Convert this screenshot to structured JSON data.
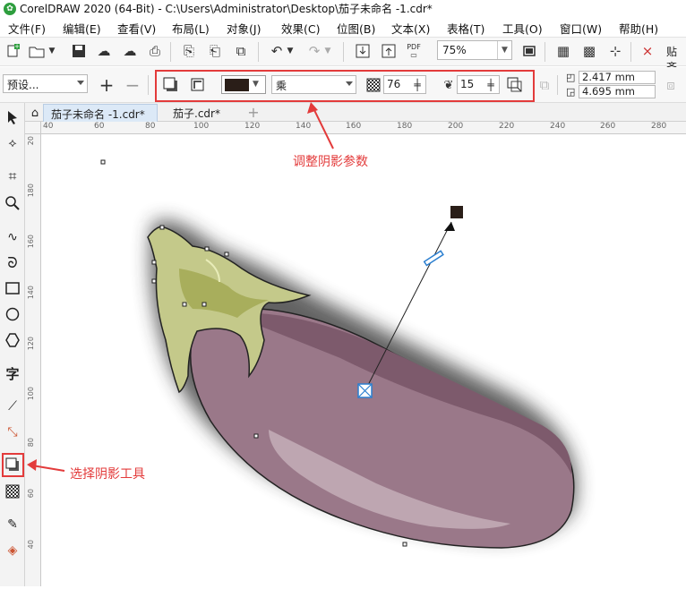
{
  "window": {
    "title": "CorelDRAW 2020 (64-Bit) - C:\\Users\\Administrator\\Desktop\\茄子未命名 -1.cdr*"
  },
  "menu": [
    {
      "label": "文件(F)"
    },
    {
      "label": "编辑(E)"
    },
    {
      "label": "查看(V)"
    },
    {
      "label": "布局(L)"
    },
    {
      "label": "对象(J)"
    },
    {
      "label": "效果(C)"
    },
    {
      "label": "位图(B)"
    },
    {
      "label": "文本(X)"
    },
    {
      "label": "表格(T)"
    },
    {
      "label": "工具(O)"
    },
    {
      "label": "窗口(W)"
    },
    {
      "label": "帮助(H)"
    }
  ],
  "toolbar": {
    "zoom": "75%",
    "pdf_label": "PDF",
    "paste_label": "贴齐"
  },
  "propbar": {
    "preset": "预设...",
    "shadow_color": "#2a1e18",
    "blend_mode": "乘",
    "opacity": "76",
    "feather": "15",
    "width": "2.417 mm",
    "height": "4.695 mm"
  },
  "tabs": [
    {
      "label": "茄子未命名 -1.cdr*",
      "active": true
    },
    {
      "label": "茄子.cdr*",
      "active": false
    }
  ],
  "hruler_ticks": [
    "40",
    "60",
    "80",
    "100",
    "120",
    "140",
    "160",
    "180",
    "200",
    "220",
    "240",
    "260",
    "280"
  ],
  "vruler_ticks": [
    "180",
    "160",
    "140",
    "120",
    "100",
    "80",
    "60",
    "40"
  ],
  "vruler_top": "20",
  "annotations": {
    "adjust_params": "调整阴影参数",
    "select_tool": "选择阴影工具"
  },
  "colors": {
    "accent_red": "#e33b3b",
    "eggplant": "#9a7889",
    "eggplant_dark": "#7d5a6c",
    "stem": "#c4c98a"
  }
}
